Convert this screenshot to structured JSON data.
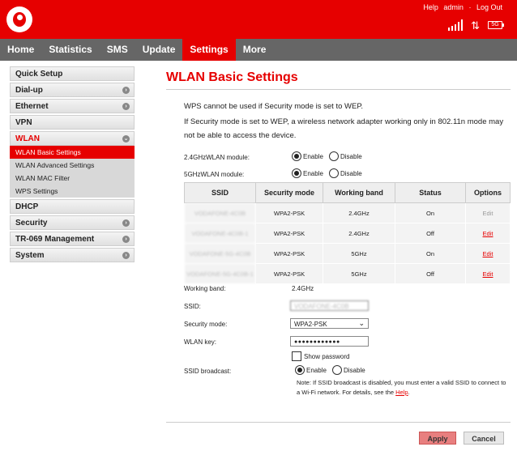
{
  "header": {
    "links": [
      "Help",
      "admin",
      "Log Out"
    ],
    "signal_icon": "signal-bars-icon",
    "transfer_icon": "up-down-arrows-icon",
    "network_badge": "5G",
    "brand_color": "#e60000"
  },
  "nav": {
    "tabs": [
      "Home",
      "Statistics",
      "SMS",
      "Update",
      "Settings",
      "More"
    ],
    "active": "Settings"
  },
  "sidebar": {
    "items": [
      {
        "label": "Quick Setup",
        "chevron": false
      },
      {
        "label": "Dial-up",
        "chevron": true
      },
      {
        "label": "Ethernet",
        "chevron": true
      },
      {
        "label": "VPN",
        "chevron": false
      },
      {
        "label": "WLAN",
        "chevron": true,
        "open": true
      },
      {
        "label": "DHCP",
        "chevron": false
      },
      {
        "label": "Security",
        "chevron": true
      },
      {
        "label": "TR-069 Management",
        "chevron": true
      },
      {
        "label": "System",
        "chevron": true
      }
    ],
    "wlan_subitems": [
      "WLAN Basic Settings",
      "WLAN Advanced Settings",
      "WLAN MAC Filter",
      "WPS Settings"
    ],
    "active_subitem": "WLAN Basic Settings"
  },
  "main": {
    "title": "WLAN Basic Settings",
    "notice_1": "WPS cannot be used if Security mode is set to WEP.",
    "notice_2": "If Security mode is set to WEP, a wireless network adapter working only in 802.11n mode may",
    "notice_3": "not be able to access the device.",
    "module_24_label": "2.4GHzWLAN module:",
    "module_5_label": "5GHzWLAN module:",
    "enable_label": "Enable",
    "disable_label": "Disable",
    "table": {
      "headers": [
        "SSID",
        "Security mode",
        "Working band",
        "Status",
        "Options"
      ],
      "rows": [
        {
          "ssid": "VODAFONE-4C0B",
          "security": "WPA2-PSK",
          "band": "2.4GHz",
          "status": "On",
          "option": "Edit",
          "option_enabled": false
        },
        {
          "ssid": "VODAFONE-4C0B-1",
          "security": "WPA2-PSK",
          "band": "2.4GHz",
          "status": "Off",
          "option": "Edit",
          "option_enabled": true
        },
        {
          "ssid": "VODAFONE-5G-4C0B",
          "security": "WPA2-PSK",
          "band": "5GHz",
          "status": "On",
          "option": "Edit",
          "option_enabled": true
        },
        {
          "ssid": "VODAFONE-5G-4C0B-1",
          "security": "WPA2-PSK",
          "band": "5GHz",
          "status": "Off",
          "option": "Edit",
          "option_enabled": true
        }
      ]
    },
    "form": {
      "working_band_label": "Working band:",
      "working_band_value": "2.4GHz",
      "ssid_label": "SSID:",
      "ssid_value": "VODAFONE-4C0B",
      "security_mode_label": "Security mode:",
      "security_mode_value": "WPA2-PSK",
      "wlan_key_label": "WLAN key:",
      "wlan_key_value": "●●●●●●●●●●●●",
      "show_password_label": "Show password",
      "ssid_broadcast_label": "SSID broadcast:",
      "note_text": "Note: If SSID broadcast is disabled, you must enter a valid SSID to connect to a Wi-Fi network. For details, see the",
      "note_link": "Help",
      "note_end": "."
    },
    "apply_label": "Apply",
    "cancel_label": "Cancel"
  }
}
